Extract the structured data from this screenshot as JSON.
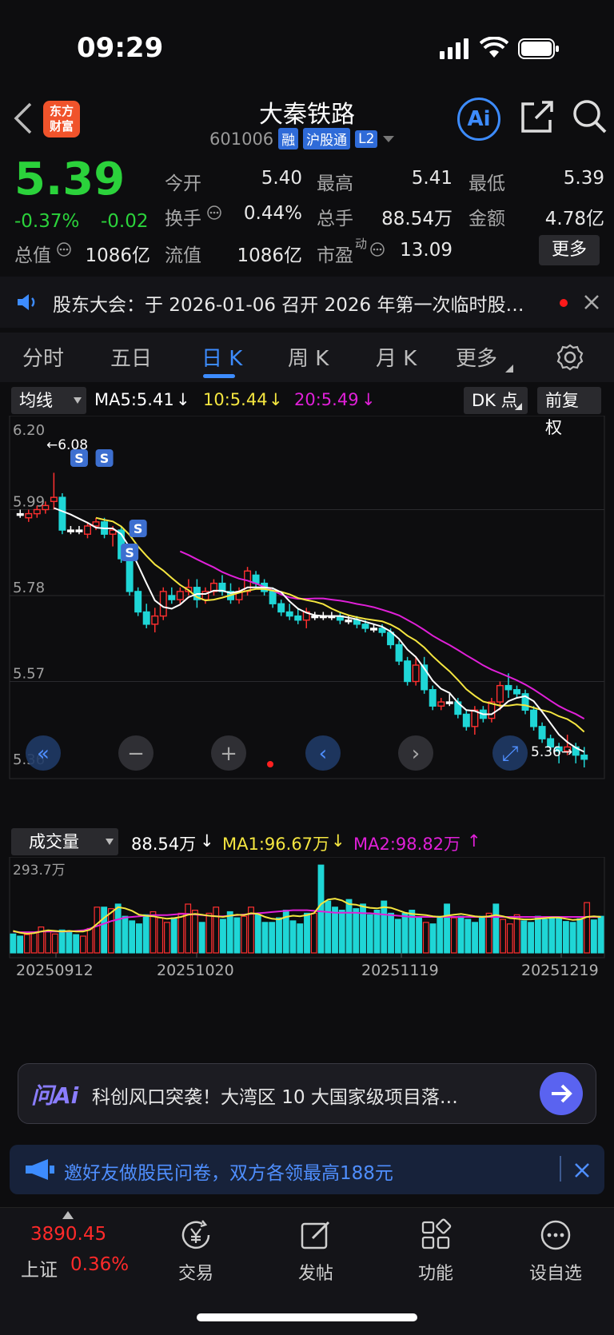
{
  "status": {
    "time": "09:29"
  },
  "nav": {
    "logo_line1": "东方",
    "logo_line2": "财富",
    "title": "大秦铁路",
    "code": "601006",
    "badge_rong": "融",
    "badge_hgt": "沪股通",
    "badge_l2": "L2",
    "ai_label": "Ai"
  },
  "quote": {
    "price": "5.39",
    "pct": "-0.37%",
    "chg": "-0.02",
    "open_label": "今开",
    "open": "5.40",
    "high_label": "最高",
    "high": "5.41",
    "low_label": "最低",
    "low": "5.39",
    "turnover_label": "换手",
    "turnover": "0.44%",
    "volume_label": "总手",
    "volume": "88.54万",
    "amount_label": "金额",
    "amount": "4.78亿",
    "mktcap_label": "总值",
    "mktcap": "1086亿",
    "float_label": "流值",
    "float": "1086亿",
    "pe_label": "市盈",
    "pe_sup": "动",
    "pe": "13.09",
    "more": "更多"
  },
  "notice": {
    "text": "股东大会：于 2026-01-06 召开 2026 年第一次临时股…"
  },
  "tabs": [
    "分时",
    "五日",
    "日 K",
    "周 K",
    "月 K",
    "更多"
  ],
  "ma": {
    "selector": "均线",
    "ma5": "MA5:5.41",
    "ma10": "10:5.44",
    "ma20": "20:5.49",
    "dk": "DK 点",
    "fq": "前复权",
    "colors": {
      "ma5": "#ffffff",
      "ma10": "#f5e640",
      "ma20": "#e020d8"
    }
  },
  "chart_data": {
    "type": "candlestick",
    "y_ticks": [
      "6.20",
      "5.99",
      "5.78",
      "5.57",
      "5.36"
    ],
    "ylim": [
      5.36,
      6.2
    ],
    "annot_high": "←6.08",
    "annot_low": "5.36→",
    "marker": "S",
    "candles": [
      [
        5.98,
        5.99,
        5.97,
        5.98
      ],
      [
        5.97,
        5.99,
        5.96,
        5.98
      ],
      [
        5.98,
        6.0,
        5.97,
        5.99
      ],
      [
        5.99,
        6.01,
        5.98,
        6.0
      ],
      [
        6.01,
        6.08,
        5.99,
        6.02
      ],
      [
        6.02,
        6.03,
        5.93,
        5.94
      ],
      [
        5.94,
        5.95,
        5.93,
        5.94
      ],
      [
        5.94,
        5.95,
        5.93,
        5.94
      ],
      [
        5.93,
        5.96,
        5.92,
        5.95
      ],
      [
        5.95,
        5.97,
        5.94,
        5.96
      ],
      [
        5.96,
        5.97,
        5.92,
        5.93
      ],
      [
        5.93,
        5.95,
        5.9,
        5.94
      ],
      [
        5.94,
        5.95,
        5.86,
        5.87
      ],
      [
        5.87,
        5.88,
        5.78,
        5.79
      ],
      [
        5.79,
        5.8,
        5.73,
        5.74
      ],
      [
        5.74,
        5.76,
        5.7,
        5.71
      ],
      [
        5.71,
        5.75,
        5.69,
        5.73
      ],
      [
        5.73,
        5.8,
        5.72,
        5.79
      ],
      [
        5.78,
        5.8,
        5.76,
        5.77
      ],
      [
        5.77,
        5.8,
        5.76,
        5.79
      ],
      [
        5.79,
        5.82,
        5.78,
        5.8
      ],
      [
        5.8,
        5.82,
        5.75,
        5.77
      ],
      [
        5.77,
        5.8,
        5.76,
        5.79
      ],
      [
        5.79,
        5.82,
        5.78,
        5.81
      ],
      [
        5.81,
        5.83,
        5.78,
        5.79
      ],
      [
        5.79,
        5.81,
        5.76,
        5.77
      ],
      [
        5.77,
        5.8,
        5.76,
        5.79
      ],
      [
        5.79,
        5.85,
        5.78,
        5.84
      ],
      [
        5.83,
        5.84,
        5.8,
        5.81
      ],
      [
        5.81,
        5.82,
        5.78,
        5.79
      ],
      [
        5.79,
        5.8,
        5.75,
        5.76
      ],
      [
        5.76,
        5.77,
        5.73,
        5.74
      ],
      [
        5.74,
        5.76,
        5.72,
        5.73
      ],
      [
        5.73,
        5.75,
        5.71,
        5.72
      ],
      [
        5.72,
        5.75,
        5.7,
        5.74
      ],
      [
        5.73,
        5.74,
        5.72,
        5.73
      ],
      [
        5.73,
        5.74,
        5.72,
        5.73
      ],
      [
        5.73,
        5.74,
        5.72,
        5.73
      ],
      [
        5.73,
        5.74,
        5.71,
        5.72
      ],
      [
        5.72,
        5.73,
        5.71,
        5.72
      ],
      [
        5.72,
        5.73,
        5.7,
        5.71
      ],
      [
        5.71,
        5.72,
        5.69,
        5.7
      ],
      [
        5.7,
        5.71,
        5.69,
        5.7
      ],
      [
        5.7,
        5.71,
        5.68,
        5.69
      ],
      [
        5.69,
        5.7,
        5.65,
        5.66
      ],
      [
        5.66,
        5.67,
        5.61,
        5.62
      ],
      [
        5.62,
        5.63,
        5.56,
        5.57
      ],
      [
        5.57,
        5.63,
        5.56,
        5.61
      ],
      [
        5.61,
        5.63,
        5.54,
        5.55
      ],
      [
        5.55,
        5.56,
        5.5,
        5.51
      ],
      [
        5.51,
        5.53,
        5.5,
        5.52
      ],
      [
        5.52,
        5.54,
        5.51,
        5.52
      ],
      [
        5.52,
        5.53,
        5.48,
        5.49
      ],
      [
        5.49,
        5.5,
        5.45,
        5.46
      ],
      [
        5.46,
        5.51,
        5.44,
        5.5
      ],
      [
        5.5,
        5.51,
        5.47,
        5.48
      ],
      [
        5.48,
        5.53,
        5.47,
        5.52
      ],
      [
        5.52,
        5.57,
        5.5,
        5.56
      ],
      [
        5.56,
        5.59,
        5.53,
        5.55
      ],
      [
        5.55,
        5.56,
        5.53,
        5.54
      ],
      [
        5.54,
        5.55,
        5.49,
        5.5
      ],
      [
        5.5,
        5.51,
        5.45,
        5.46
      ],
      [
        5.46,
        5.47,
        5.42,
        5.43
      ],
      [
        5.43,
        5.44,
        5.4,
        5.41
      ],
      [
        5.41,
        5.42,
        5.37,
        5.4
      ],
      [
        5.4,
        5.44,
        5.39,
        5.41
      ],
      [
        5.41,
        5.42,
        5.37,
        5.39
      ],
      [
        5.39,
        5.41,
        5.36,
        5.38
      ]
    ],
    "volume": {
      "label": "成交量",
      "value": "88.54万",
      "ma1": "MA1:96.67万",
      "ma2": "MA2:98.82万",
      "max_label": "293.7万",
      "max": 293.7,
      "dates": [
        "20250912",
        "20251020",
        "20251119",
        "20251219"
      ],
      "bars": [
        62,
        55,
        60,
        68,
        85,
        70,
        62,
        75,
        68,
        60,
        55,
        80,
        150,
        150,
        145,
        160,
        120,
        105,
        95,
        125,
        135,
        115,
        100,
        115,
        130,
        160,
        140,
        100,
        130,
        150,
        110,
        135,
        115,
        120,
        150,
        125,
        100,
        100,
        115,
        140,
        105,
        95,
        130,
        130,
        288,
        170,
        150,
        140,
        175,
        145,
        160,
        125,
        140,
        170,
        130,
        110,
        130,
        140,
        115,
        100,
        95,
        120,
        160,
        115,
        120,
        110,
        100,
        120,
        130,
        160,
        110,
        95,
        125,
        105,
        100,
        120,
        110,
        115,
        118,
        103,
        100,
        112,
        165,
        108,
        120
      ],
      "ma1_line": [
        72,
        66,
        63,
        65,
        70,
        74,
        72,
        70,
        72,
        70,
        70,
        76,
        95,
        115,
        132,
        150,
        146,
        138,
        125,
        122,
        120,
        116,
        112,
        114,
        118,
        125,
        128,
        125,
        122,
        120,
        118,
        122,
        125,
        124,
        130,
        128,
        118,
        112,
        110,
        118,
        122,
        120,
        124,
        130,
        160,
        175,
        178,
        172,
        160,
        158,
        152,
        148,
        146,
        150,
        148,
        140,
        132,
        128,
        126,
        124,
        120,
        118,
        122,
        125,
        128,
        124,
        120,
        118,
        120,
        124,
        120,
        114,
        112,
        110,
        110,
        112,
        114,
        116,
        116,
        112,
        108,
        110,
        118,
        120,
        118
      ],
      "ma2_line": [
        70,
        68,
        68,
        68,
        70,
        70,
        70,
        70,
        70,
        72,
        74,
        80,
        88,
        96,
        104,
        110,
        116,
        118,
        120,
        122,
        124,
        124,
        124,
        126,
        128,
        128,
        126,
        124,
        122,
        120,
        120,
        122,
        124,
        126,
        128,
        130,
        132,
        134,
        136,
        138,
        140,
        140,
        140,
        138,
        136,
        134,
        132,
        132,
        132,
        132,
        130,
        130,
        128,
        126,
        124,
        122,
        120,
        118,
        118,
        118,
        118,
        118,
        118,
        118,
        118,
        118,
        118,
        118,
        118,
        118,
        118,
        118,
        118,
        118,
        118,
        118,
        118,
        118,
        118,
        118,
        118,
        118,
        118,
        118,
        118
      ]
    }
  },
  "ai": {
    "logo": "问Ai",
    "text": "科创风口突袭！大湾区 10 大国家级项目落…"
  },
  "invite": {
    "text": "邀好友做股民问卷，双方各领最高188元"
  },
  "bottom": {
    "index_value": "3890.45",
    "index_name": "上证",
    "index_pct": "0.36%",
    "trade": "交易",
    "post": "发帖",
    "func": "功能",
    "watch": "设自选"
  }
}
